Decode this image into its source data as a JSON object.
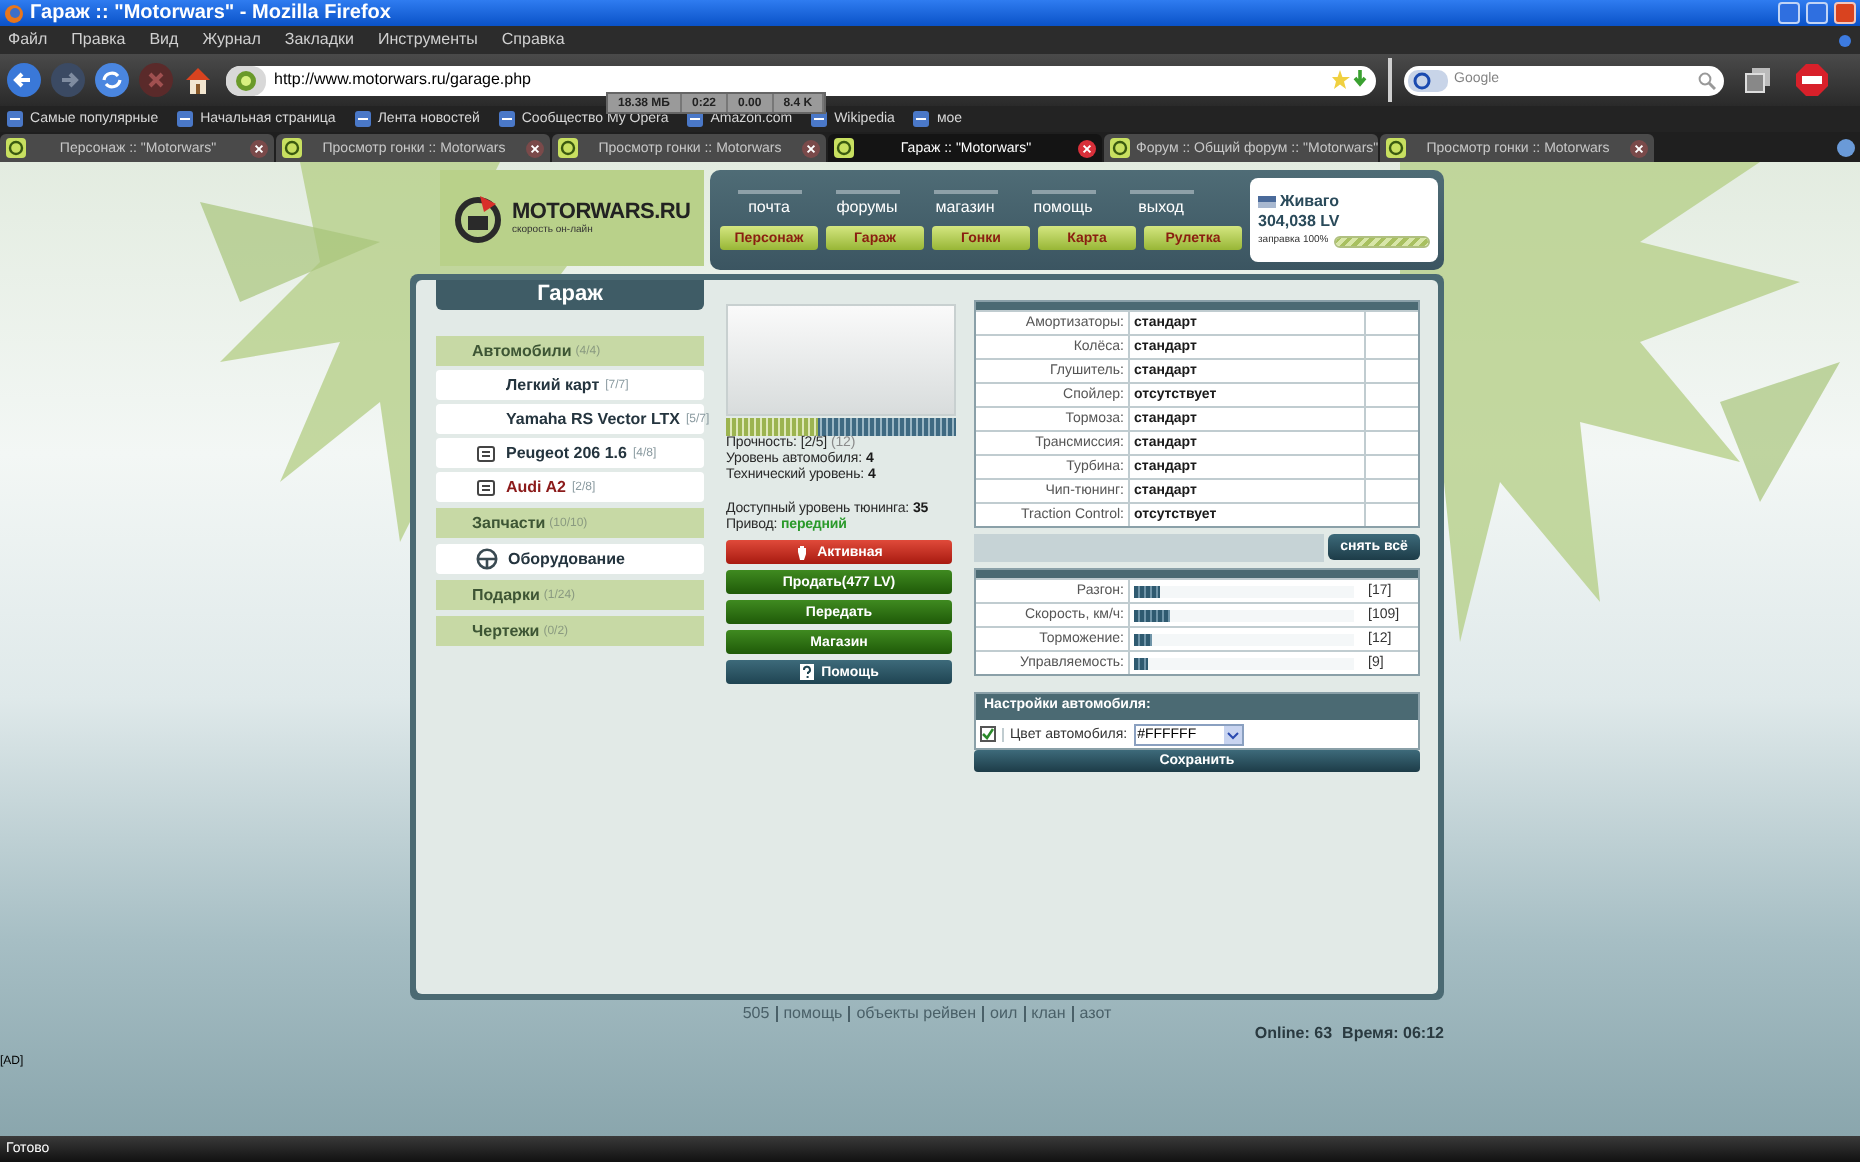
{
  "window": {
    "title": "Гараж :: \"Motorwars\" - Mozilla Firefox"
  },
  "menu": [
    "Файл",
    "Правка",
    "Вид",
    "Журнал",
    "Закладки",
    "Инструменты",
    "Справка"
  ],
  "address_bar": {
    "value": "http://www.motorwars.ru/garage.php"
  },
  "search": {
    "placeholder": "Google"
  },
  "memory_monitor": [
    "18.38 МБ",
    "0:22",
    "0.00",
    "8.4 K"
  ],
  "bookmarks": [
    "Самые популярные",
    "Начальная страница",
    "Лента новостей",
    "Сообщество My Opera",
    "Amazon.com",
    "Wikipedia",
    "мое"
  ],
  "tabs": [
    {
      "label": "Персонаж :: \"Motorwars\"",
      "selected": false
    },
    {
      "label": "Просмотр гонки :: Motorwars",
      "selected": false
    },
    {
      "label": "Просмотр гонки :: Motorwars",
      "selected": false
    },
    {
      "label": "Гараж :: \"Motorwars\"",
      "selected": true
    },
    {
      "label": "Форум :: Общий форум :: \"Motorwars\"",
      "selected": false
    },
    {
      "label": "Просмотр гонки :: Motorwars",
      "selected": false
    }
  ],
  "site": {
    "logo": {
      "title": "MOTORWARS.RU",
      "tagline": "скорость он-лайн"
    },
    "top_links": [
      "почта",
      "форумы",
      "магазин",
      "помощь",
      "выход"
    ],
    "nav_buttons": [
      "Персонаж",
      "Гараж",
      "Гонки",
      "Карта",
      "Рулетка"
    ],
    "user": {
      "name": "Живаго",
      "balance": "304,038 LV",
      "fuel": {
        "label": "заправка 100%",
        "level": 1.0
      }
    }
  },
  "garage": {
    "title": "Гараж",
    "sidebar": [
      {
        "kind": "section",
        "label": "Автомобили",
        "count": "(4/4)"
      },
      {
        "kind": "car",
        "label": "Легкий карт",
        "count": "[7/7]",
        "selected": false
      },
      {
        "kind": "car",
        "label": "Yamaha RS Vector LTX",
        "count": "[5/7]",
        "selected": false
      },
      {
        "kind": "car_with_emblem",
        "label": "Peugeot 206 1.6",
        "count": "[4/8]",
        "selected": false
      },
      {
        "kind": "car_with_emblem",
        "label": "Audi A2",
        "count": "[2/8]",
        "selected": true
      },
      {
        "kind": "section",
        "label": "Запчасти",
        "count": "(10/10)"
      },
      {
        "kind": "equipment",
        "label": "Оборудование"
      },
      {
        "kind": "section",
        "label": "Подарки",
        "count": "(1/24)"
      },
      {
        "kind": "section",
        "label": "Чертежи",
        "count": "(0/2)"
      }
    ],
    "car": {
      "durability": {
        "level": 0.4
      },
      "info": [
        {
          "kind": "durability",
          "label": "Прочность:",
          "value": "[2/5]",
          "note": "(12)"
        },
        {
          "kind": "bold",
          "label": "Уровень автомобиля:",
          "value": "4"
        },
        {
          "kind": "bold",
          "label": "Технический уровень:",
          "value": "4"
        },
        {
          "kind": "bold",
          "label": "Доступный уровень тюнинга:",
          "value": "35"
        },
        {
          "kind": "green",
          "label": "Привод:",
          "value": "передний"
        }
      ],
      "buttons": [
        {
          "kind": "status",
          "label": "Активная"
        },
        {
          "kind": "action",
          "label": "Продать(477 LV)"
        },
        {
          "kind": "action",
          "label": "Передать"
        },
        {
          "kind": "action",
          "label": "Магазин"
        },
        {
          "kind": "help",
          "label": "Помощь"
        }
      ]
    },
    "parts": [
      {
        "label": "Амортизаторы:",
        "value": "стандарт"
      },
      {
        "label": "Колёса:",
        "value": "стандарт"
      },
      {
        "label": "Глушитель:",
        "value": "стандарт"
      },
      {
        "label": "Спойлер:",
        "value": "отсутствует"
      },
      {
        "label": "Тормоза:",
        "value": "стандарт"
      },
      {
        "label": "Трансмиссия:",
        "value": "стандарт"
      },
      {
        "label": "Турбина:",
        "value": "стандарт"
      },
      {
        "label": "Чип-тюнинг:",
        "value": "стандарт"
      },
      {
        "label": "Traction Control:",
        "value": "отсутствует"
      }
    ],
    "remove_all_button": "снять всё",
    "stats": [
      {
        "label": "Разгон:",
        "level": 0.12,
        "reading": "[17]"
      },
      {
        "label": "Скорость, км/ч:",
        "level": 0.16,
        "reading": "[109]"
      },
      {
        "label": "Торможение:",
        "level": 0.08,
        "reading": "[12]"
      },
      {
        "label": "Управляемость:",
        "level": 0.06,
        "reading": "[9]"
      }
    ],
    "settings": {
      "title": "Настройки автомобиля:",
      "checked": true,
      "color_label": "Цвет автомобиля:",
      "color_value": "#FFFFFF",
      "save_button": "Сохранить"
    }
  },
  "footer": {
    "links": [
      "505",
      "помощь",
      "объекты рейвен",
      "оил",
      "клан",
      "азот"
    ],
    "online": "Online: 63",
    "time": "Время: 06:12"
  },
  "ad": "[AD]",
  "status_bar": "Готово"
}
